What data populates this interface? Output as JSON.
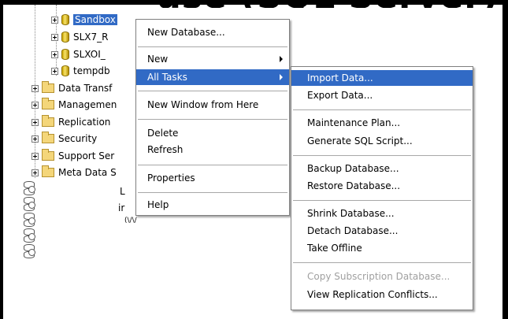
{
  "banner": {
    "text": "ase (SQL Server)"
  },
  "tree": {
    "databases": [
      {
        "label": "Sandbox",
        "selected": true
      },
      {
        "label": "SLX7_R"
      },
      {
        "label": "SLXOI_"
      },
      {
        "label": "tempdb"
      }
    ],
    "folders": [
      {
        "label": "Data Transf"
      },
      {
        "label": "Managemen"
      },
      {
        "label": "Replication"
      },
      {
        "label": "Security"
      },
      {
        "label": "Support Ser"
      },
      {
        "label": "Meta Data S"
      }
    ],
    "stubs": [
      {
        "label": "L"
      },
      {
        "label": "ir"
      },
      {
        "label": "(\\/\\/"
      }
    ]
  },
  "context_menu": {
    "items": [
      {
        "label": "New Database..."
      },
      {
        "label": "New",
        "submenu": true
      },
      {
        "label": "All Tasks",
        "submenu": true,
        "selected": true
      },
      {
        "label": "New Window from Here"
      },
      {
        "label": "Delete"
      },
      {
        "label": "Refresh"
      },
      {
        "label": "Properties"
      },
      {
        "label": "Help"
      }
    ]
  },
  "submenu": {
    "items": [
      {
        "label": "Import Data...",
        "selected": true
      },
      {
        "label": "Export Data..."
      },
      {
        "label": "Maintenance Plan..."
      },
      {
        "label": "Generate SQL Script..."
      },
      {
        "label": "Backup Database..."
      },
      {
        "label": "Restore Database..."
      },
      {
        "label": "Shrink Database..."
      },
      {
        "label": "Detach Database..."
      },
      {
        "label": "Take Offline"
      },
      {
        "label": "Copy Subscription Database...",
        "disabled": true
      },
      {
        "label": "View Replication Conflicts..."
      }
    ]
  },
  "colors": {
    "selection": "#316ac5",
    "folder": "#f4d67a",
    "db": "#e8c93a"
  }
}
